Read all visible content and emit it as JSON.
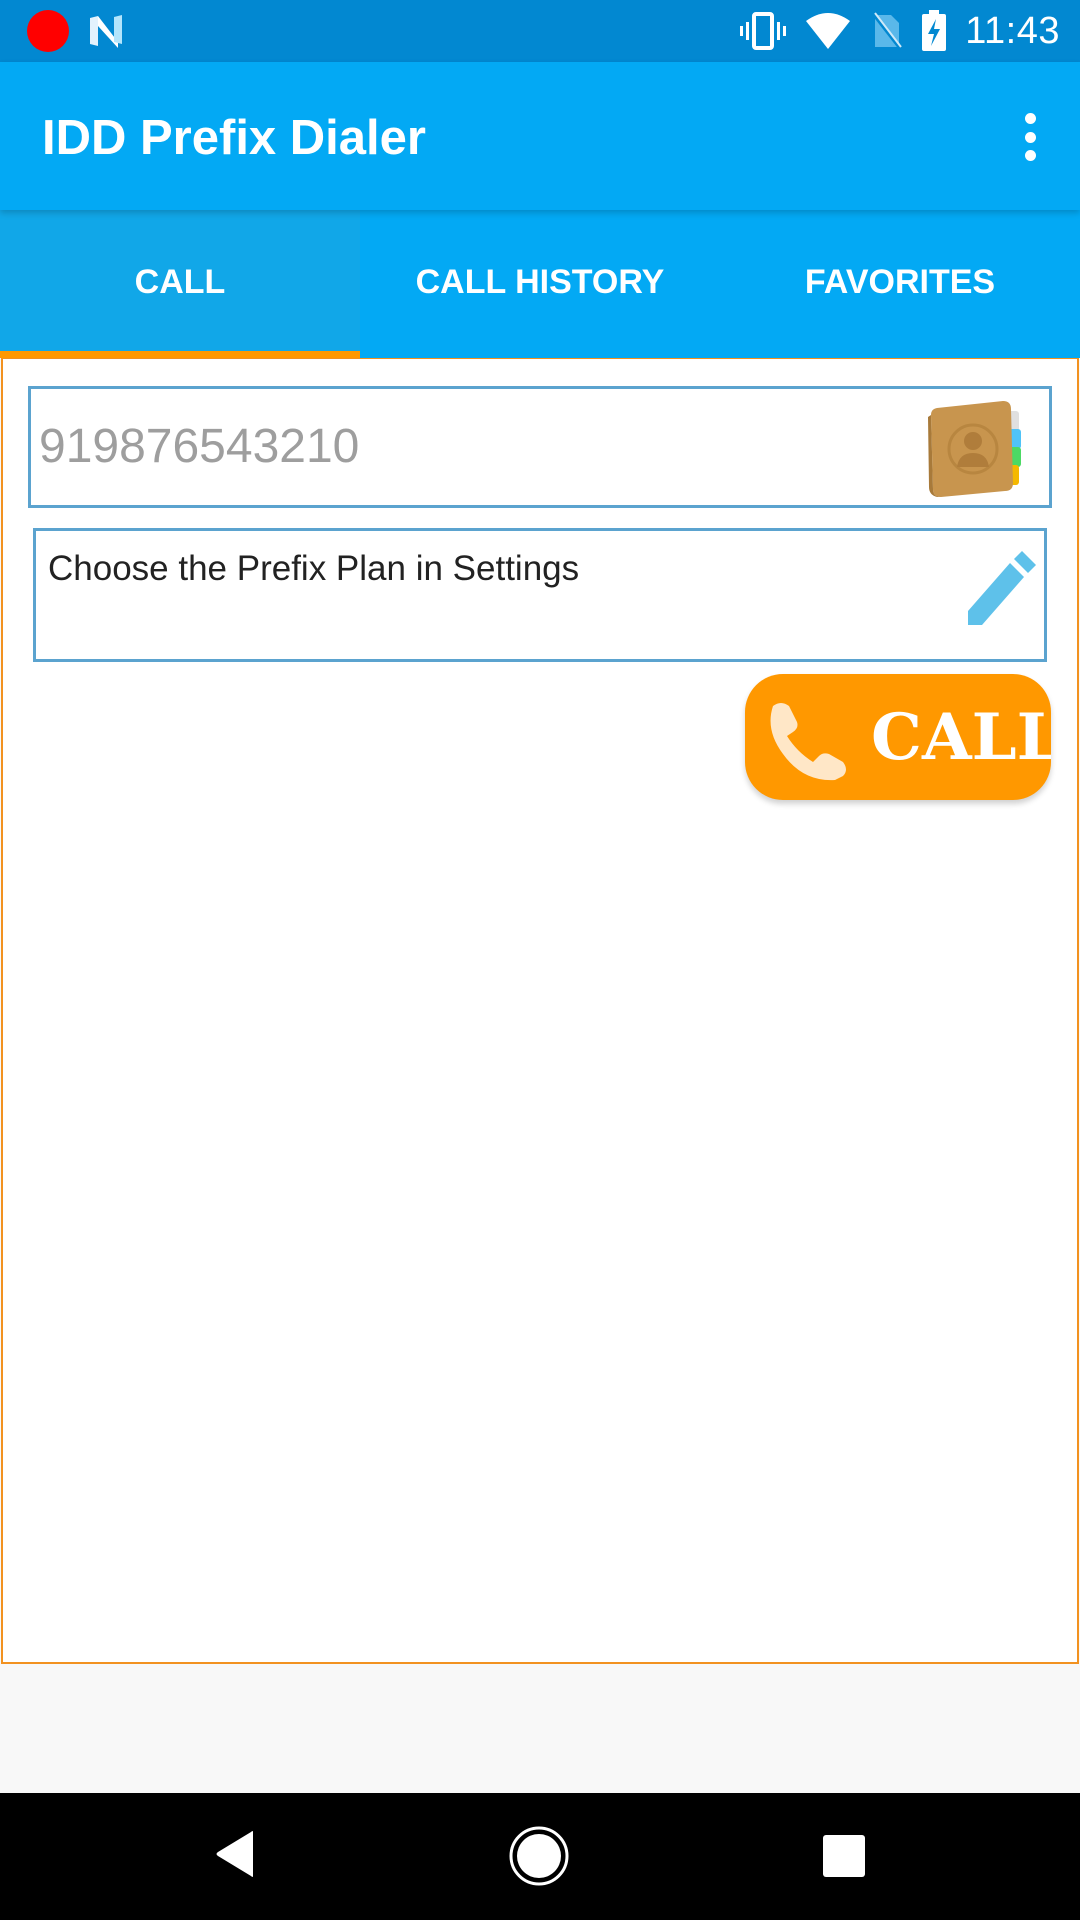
{
  "status_bar": {
    "time": "11:43",
    "left_icons": [
      "record-indicator-icon",
      "n-notification-icon"
    ],
    "right_icons": [
      "vibrate-icon",
      "wifi-icon",
      "no-sim-icon",
      "battery-charging-icon"
    ]
  },
  "app_bar": {
    "title": "IDD Prefix Dialer",
    "overflow_icon": "more-vert-icon"
  },
  "tabs": [
    {
      "label": "CALL",
      "active": true
    },
    {
      "label": "CALL HISTORY",
      "active": false
    },
    {
      "label": "FAVORITES",
      "active": false
    }
  ],
  "call_tab": {
    "phone_input": {
      "placeholder": "919876543210",
      "value": "",
      "icon": "contacts-book-icon"
    },
    "prefix_plan": {
      "text": "Choose the Prefix Plan in Settings",
      "icon": "edit-pencil-icon"
    },
    "call_button": {
      "label": "CALL",
      "icon": "phone-handset-icon"
    }
  },
  "nav_bar": {
    "buttons": [
      "back",
      "home",
      "recents"
    ]
  },
  "colors": {
    "status_bar": "#0288d1",
    "primary": "#03a9f4",
    "accent": "#ff9800",
    "field_border": "#5ba3cf",
    "content_border": "#f29220"
  }
}
